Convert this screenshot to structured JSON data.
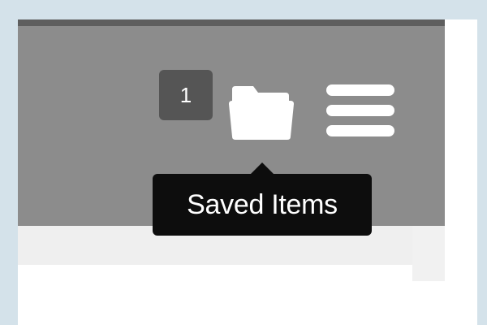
{
  "header": {
    "saved_count": "1",
    "folder_icon": "folder-icon",
    "menu_icon": "hamburger-menu-icon"
  },
  "tooltip": {
    "text": "Saved Items"
  },
  "colors": {
    "header_bg": "#8c8c8c",
    "badge_bg": "#555555",
    "tooltip_bg": "#0d0d0d",
    "frame": "#d4e2ea"
  }
}
